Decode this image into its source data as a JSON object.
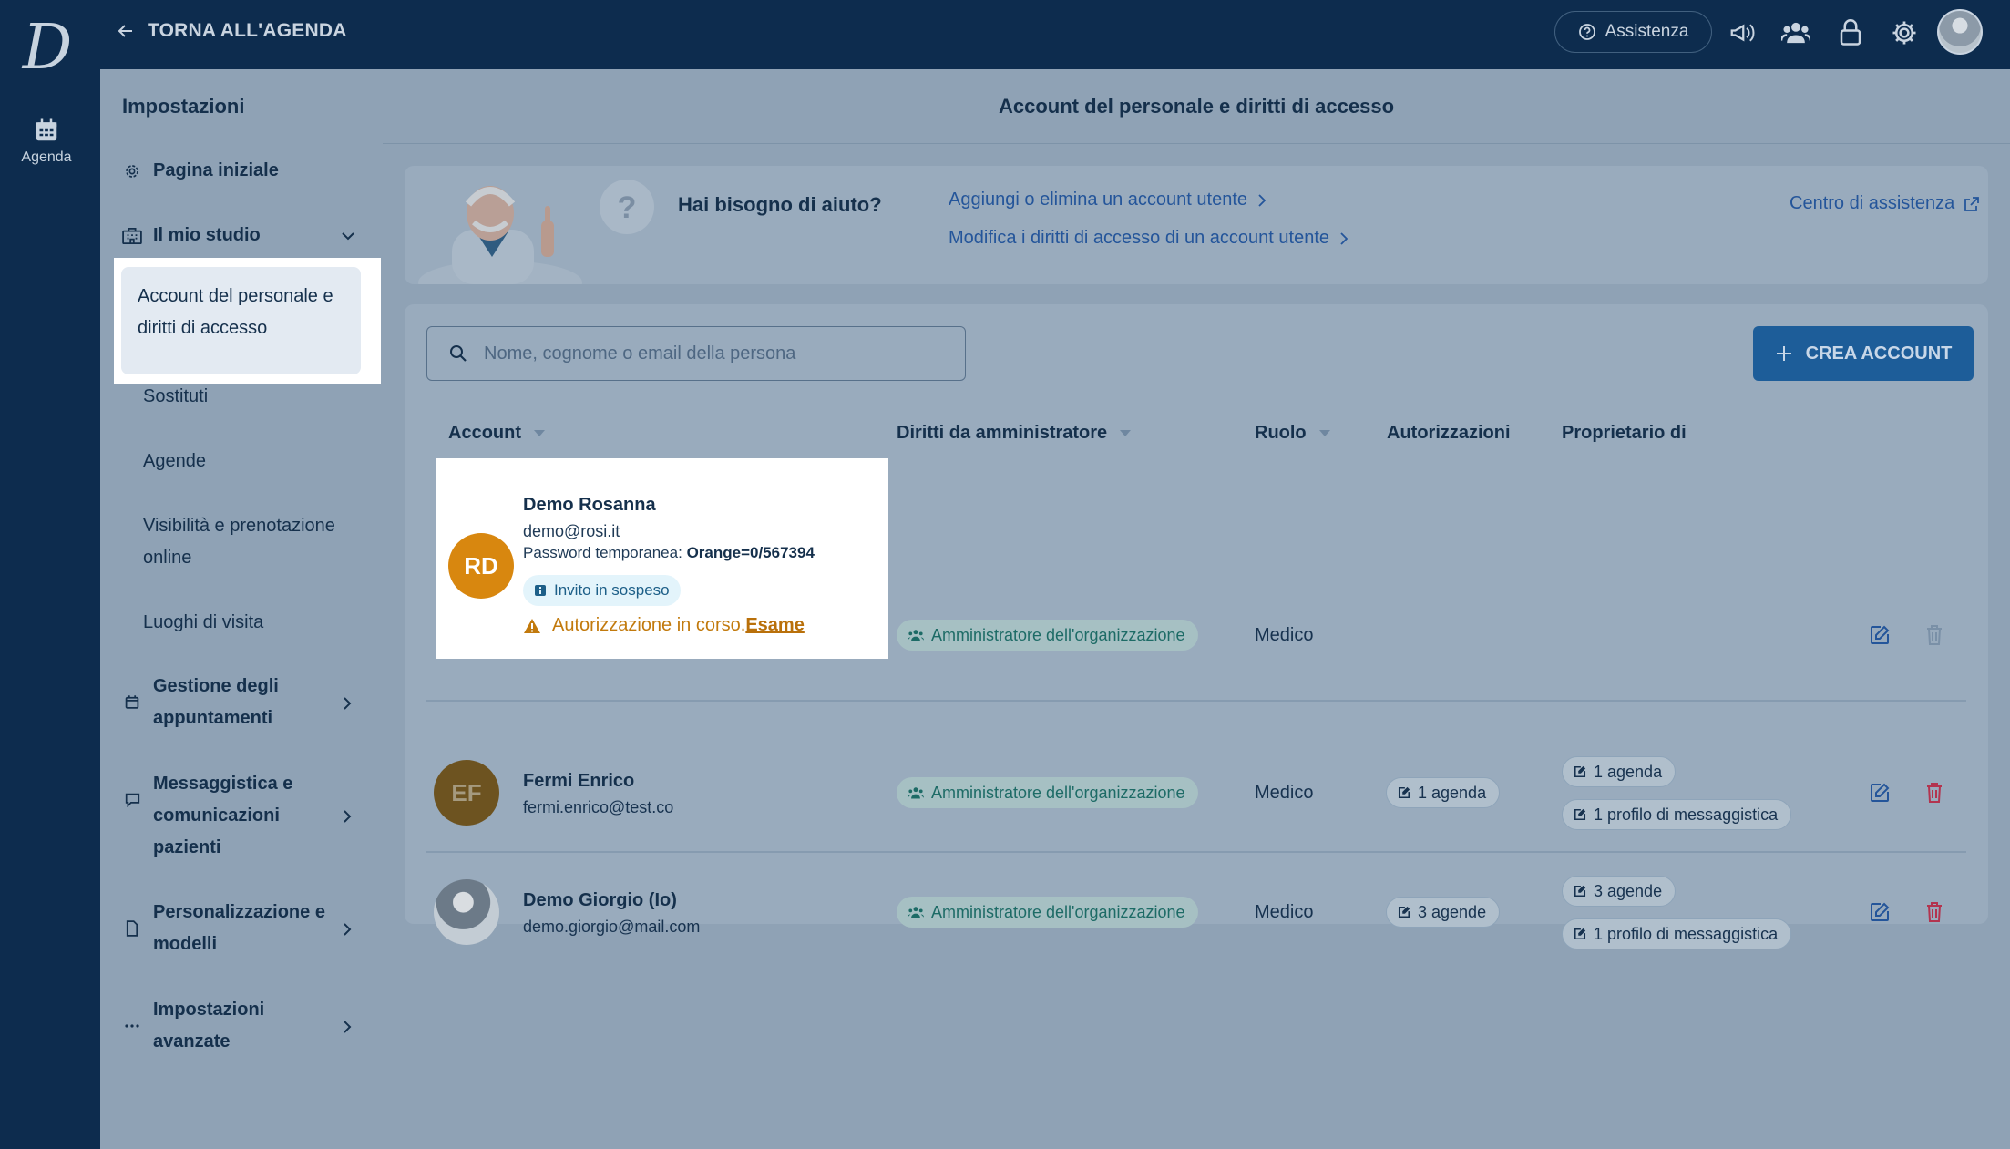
{
  "rail": {
    "logo": "D",
    "agenda_label": "Agenda"
  },
  "topbar": {
    "back_label": "TORNA ALL'AGENDA",
    "assist_label": "Assistenza"
  },
  "settings": {
    "title": "Impostazioni",
    "home": "Pagina iniziale",
    "studio": "Il mio studio",
    "active_line1": "Account del personale e",
    "active_line2": "diritti di accesso",
    "sub_items": [
      "Sostituti",
      "Agende",
      "Visibilità e prenotazione",
      "online",
      "Luoghi di visita"
    ],
    "gestione_1": "Gestione degli",
    "gestione_2": "appuntamenti",
    "messaggi_1": "Messaggistica e",
    "messaggi_2": "comunicazioni",
    "messaggi_3": "pazienti",
    "personal_1": "Personalizzazione e",
    "personal_2": "modelli",
    "avanzate_1": "Impostazioni",
    "avanzate_2": "avanzate"
  },
  "main": {
    "title": "Account del personale e diritti di accesso",
    "help": {
      "title": "Hai bisogno di aiuto?",
      "link1": "Aggiungi o elimina un account utente",
      "link2": "Modifica i diritti di accesso di un account utente",
      "center": "Centro di assistenza"
    },
    "search_placeholder": "Nome, cognome o email della persona",
    "create_label": "CREA ACCOUNT",
    "columns": {
      "account": "Account",
      "admin": "Diritti da amministratore",
      "role": "Ruolo",
      "auth": "Autorizzazioni",
      "owner": "Proprietario di"
    },
    "rows": [
      {
        "initials": "RD",
        "name": "Demo Rosanna",
        "email": "demo@rosi.it",
        "temp_label": "Password temporanea:",
        "temp_value": "Orange=0/567394",
        "invite": "Invito in sospeso",
        "warn_text": "Autorizzazione in corso.",
        "warn_link": "Esame",
        "admin": "Amministratore dell'organizzazione",
        "role": "Medico"
      },
      {
        "initials": "EF",
        "name": "Fermi Enrico",
        "email": "fermi.enrico@test.co",
        "admin": "Amministratore dell'organizzazione",
        "role": "Medico",
        "auth": "1 agenda",
        "owner1": "1 agenda",
        "owner2": "1 profilo di messaggistica"
      },
      {
        "name": "Demo Giorgio (Io)",
        "email": "demo.giorgio@mail.com",
        "admin": "Amministratore dell'organizzazione",
        "role": "Medico",
        "auth": "3 agende",
        "owner1": "3 agende",
        "owner2": "1 profilo di messaggistica"
      }
    ]
  },
  "colors": {
    "primary": "#1d5d99",
    "overlay_bg": "#8fa2b5",
    "nav_bg": "#0d2c4e",
    "warn": "#c27a0d",
    "delete": "#b3344f"
  }
}
